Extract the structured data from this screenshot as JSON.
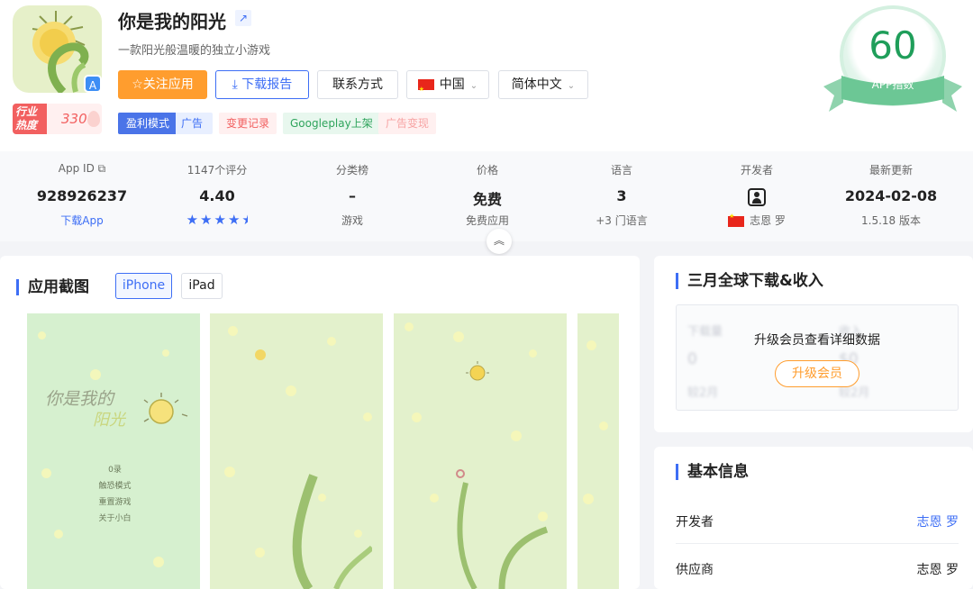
{
  "app": {
    "title": "你是我的阳光",
    "subtitle": "一款阳光般温暖的独立小游戏",
    "heat_label": "行业热度",
    "heat_value": "330"
  },
  "actions": {
    "follow": "☆关注应用",
    "report": "⤓ 下载报告",
    "contact": "联系方式",
    "region": "中国",
    "language": "简体中文"
  },
  "tags": {
    "model_left": "盈利模式",
    "model_right": "广告",
    "change_log": "变更记录",
    "googleplay": "Googleplay上架",
    "ad_monetize": "广告变现"
  },
  "score": {
    "value": "60",
    "label": "APP指数"
  },
  "stats": [
    {
      "label": "App ID",
      "value": "928926237",
      "sub": "下载App"
    },
    {
      "label": "1147个评分",
      "value": "4.40",
      "sub": ""
    },
    {
      "label": "分类榜",
      "value": "–",
      "sub": "游戏"
    },
    {
      "label": "价格",
      "value": "免费",
      "sub": "免费应用"
    },
    {
      "label": "语言",
      "value": "3",
      "sub": "+3 门语言"
    },
    {
      "label": "开发者",
      "value": "",
      "sub": "志恩 罗"
    },
    {
      "label": "最新更新",
      "value": "2024-02-08",
      "sub": "1.5.18 版本"
    }
  ],
  "rating": 4.4,
  "screenshots": {
    "title": "应用截图",
    "tab_iphone": "iPhone",
    "tab_ipad": "iPad",
    "shot1_title1": "你是我的",
    "shot1_title2": "阳光",
    "shot1_menu": [
      "0录",
      "触恐模式",
      "重置游戏",
      "关于小白"
    ]
  },
  "downloads": {
    "title": "三月全球下载&收入",
    "blur_labels": [
      "下载量",
      "收入",
      "0",
      "$0",
      "较2月",
      "较2月"
    ],
    "locked_message": "升级会员查看详细数据",
    "upgrade": "升级会员"
  },
  "basic_info": {
    "title": "基本信息",
    "rows": [
      {
        "key": "开发者",
        "value": "志恩 罗"
      },
      {
        "key": "供应商",
        "value": "志恩 罗"
      }
    ]
  },
  "colors": {
    "accent": "#3d6ef5",
    "orange": "#ff9d2e",
    "score_green": "#1f9e5a"
  }
}
